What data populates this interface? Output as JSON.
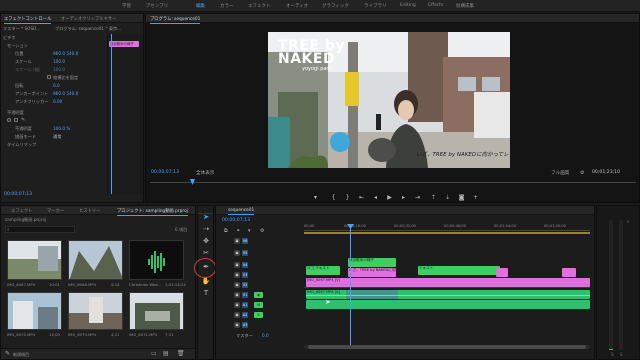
{
  "workspaces": [
    "学習",
    "アセンブリ",
    "編集",
    "カラー",
    "エフェクト",
    "オーディオ",
    "グラフィック",
    "ライブラリ",
    "Editing",
    "Effects",
    "仮構成集"
  ],
  "workspace_active": "編集",
  "effect_controls": {
    "tabs": [
      "エフェクトコントロール",
      "オーディオクリップミキサー"
    ],
    "header_source": "マスター * SOSD...",
    "header_clip": "プログラム: sequence01 * 東京...",
    "section_video": "ビデオ",
    "rows": [
      {
        "label": "モーション",
        "value": ""
      },
      {
        "label": "位置",
        "value": "960.0   540.0"
      },
      {
        "label": "スケール",
        "value": "100.0"
      },
      {
        "label": "スケール (幅)",
        "value": "100.0"
      },
      {
        "label": "縦横比を固定",
        "value": ""
      },
      {
        "label": "回転",
        "value": "0.0"
      },
      {
        "label": "アンカーポイント",
        "value": "960.0   540.0"
      },
      {
        "label": "アンチフリッカー",
        "value": "0.00"
      },
      {
        "label": "不透明度",
        "value": ""
      },
      {
        "label": "不透明度",
        "value": "100.0 %"
      },
      {
        "label": "描画モード",
        "value": "通常"
      },
      {
        "label": "タイムリマップ",
        "value": ""
      }
    ],
    "bottom_timecode": "00;00;07;13",
    "clip_chip": "東京散歩の様子"
  },
  "program_monitor": {
    "title": "プログラム: sequence01",
    "overlay_title": "TREE by NAKED",
    "overlay_sub": "yoyogi park",
    "caption": "いざ、TREE by NAKEDに向かってレッツゴー！",
    "timecode_current": "00;00;07;13",
    "fit_label": "全体表示",
    "quality": "フル画質",
    "timecode_duration": "00;01;23;10"
  },
  "project_panel": {
    "tabs": [
      "エフェクト",
      "マーカー",
      "ヒストリー",
      "プロジェクト: sampling動画.prproj"
    ],
    "search_placeholder": "sampling動画.prproj",
    "item_count": "6 項目",
    "items": [
      {
        "name": "IMG_6067.MP4",
        "duration": "10;01"
      },
      {
        "name": "IMG_6068.MP4",
        "duration": "5;14"
      },
      {
        "name": "Christmas Wea...",
        "duration": "1;01;14;24"
      },
      {
        "name": "IMG_6075.MP4",
        "duration": "14;00"
      },
      {
        "name": "IMG_6070.MP4",
        "duration": "4;21"
      },
      {
        "name": "IMG_6071.MP4",
        "duration": "7;21"
      }
    ],
    "bottom_label": "新規項目"
  },
  "timeline": {
    "title": "sequence01",
    "timecode": "00;00;07;13",
    "ruler": [
      "00;00",
      "00;00;16;00",
      "00;00;32;00",
      "00;00;48;00",
      "00;01;04;00",
      "00;01;20;00"
    ],
    "tracks": [
      "V6",
      "V5",
      "V4",
      "V3",
      "V2",
      "V1",
      "A1",
      "A2",
      "A3"
    ],
    "master_label": "マスター",
    "master_value": "0.0",
    "clips": {
      "title_green_1": "ロゴ テキスト",
      "title_green_2": "東京散歩の様子",
      "title_pink_1": "いざ、TREE by NAKEDに向かって",
      "title_green_3": "テキスト",
      "video_main": "IMG_6067.MP4 [V]",
      "audio_main": "IMG_6067.MP4 [A]"
    }
  },
  "colors": {
    "accent_blue": "#4aa0ff",
    "clip_green": "#3ecf5c",
    "clip_pink": "#e06fe0",
    "clip_audio": "#2fbf6f",
    "highlight_red": "#d83a3a"
  }
}
